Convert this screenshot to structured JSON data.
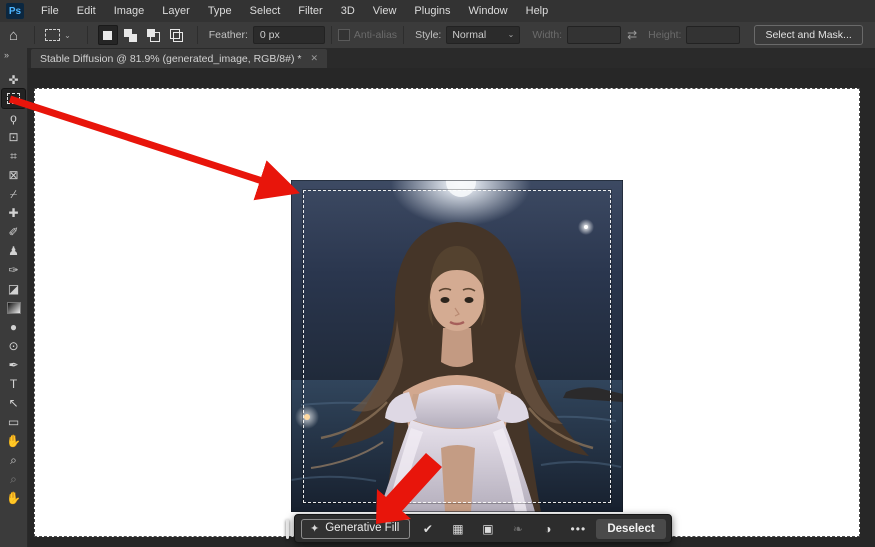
{
  "app": {
    "logo": "Ps"
  },
  "menu": {
    "items": [
      "File",
      "Edit",
      "Image",
      "Layer",
      "Type",
      "Select",
      "Filter",
      "3D",
      "View",
      "Plugins",
      "Window",
      "Help"
    ]
  },
  "options": {
    "preset_caret": "⌄",
    "feather_label": "Feather:",
    "feather_value": "0 px",
    "anti_alias_label": "Anti-alias",
    "style_label": "Style:",
    "style_value": "Normal",
    "style_caret": "⌄",
    "width_label": "Width:",
    "width_value": "",
    "link_glyph": "⇄",
    "height_label": "Height:",
    "height_value": "",
    "select_mask_label": "Select and Mask..."
  },
  "tab": {
    "title": "Stable Diffusion @ 81.9% (generated_image, RGB/8#) *",
    "close_glyph": "✕"
  },
  "toolbar": {
    "expand_glyph": "»",
    "tools": [
      {
        "name": "move-tool",
        "glyph": "✜"
      },
      {
        "name": "rectangular-marquee-tool",
        "type": "marquee",
        "selected": true
      },
      {
        "name": "lasso-tool",
        "glyph": "ϙ"
      },
      {
        "name": "object-selection-tool",
        "glyph": "⊡"
      },
      {
        "name": "crop-tool",
        "glyph": "⌗"
      },
      {
        "name": "frame-tool",
        "glyph": "⊠"
      },
      {
        "name": "eyedropper-tool",
        "glyph": "⌿"
      },
      {
        "name": "healing-brush-tool",
        "glyph": "✚"
      },
      {
        "name": "brush-tool",
        "glyph": "✐"
      },
      {
        "name": "clone-stamp-tool",
        "glyph": "♟"
      },
      {
        "name": "history-brush-tool",
        "glyph": "✑"
      },
      {
        "name": "eraser-tool",
        "glyph": "◪"
      },
      {
        "name": "gradient-tool",
        "type": "gradient"
      },
      {
        "name": "blur-tool",
        "glyph": "●"
      },
      {
        "name": "dodge-tool",
        "glyph": "⊙"
      },
      {
        "name": "pen-tool",
        "glyph": "✒"
      },
      {
        "name": "type-tool",
        "glyph": "T"
      },
      {
        "name": "path-selection-tool",
        "glyph": "↖"
      },
      {
        "name": "rectangle-tool",
        "glyph": "▭"
      },
      {
        "name": "hand-tool",
        "glyph": "✋"
      },
      {
        "name": "zoom-tool",
        "glyph": "⌕"
      },
      {
        "name": "zoom-tool-alt",
        "glyph": "⌕",
        "dim": true
      },
      {
        "name": "hand-tool-alt",
        "glyph": "✋"
      }
    ]
  },
  "taskbar": {
    "generative_fill_label": "Generative Fill",
    "generative_fill_icon": "✦",
    "icons": [
      {
        "name": "selection-brush-icon",
        "glyph": "✔"
      },
      {
        "name": "adjustments-icon",
        "glyph": "▦"
      },
      {
        "name": "mask-icon",
        "glyph": "▣"
      },
      {
        "name": "feather-icon",
        "glyph": "❧",
        "dim": true
      },
      {
        "name": "invert-selection-icon",
        "glyph": "◑"
      },
      {
        "name": "more-options-icon",
        "glyph": "•••"
      }
    ],
    "deselect_label": "Deselect"
  },
  "colors": {
    "annotation_red": "#e8150b",
    "logo_blue": "#31a8ff",
    "panel_gray": "#3b3b3b",
    "pasteboard": "#272727"
  }
}
